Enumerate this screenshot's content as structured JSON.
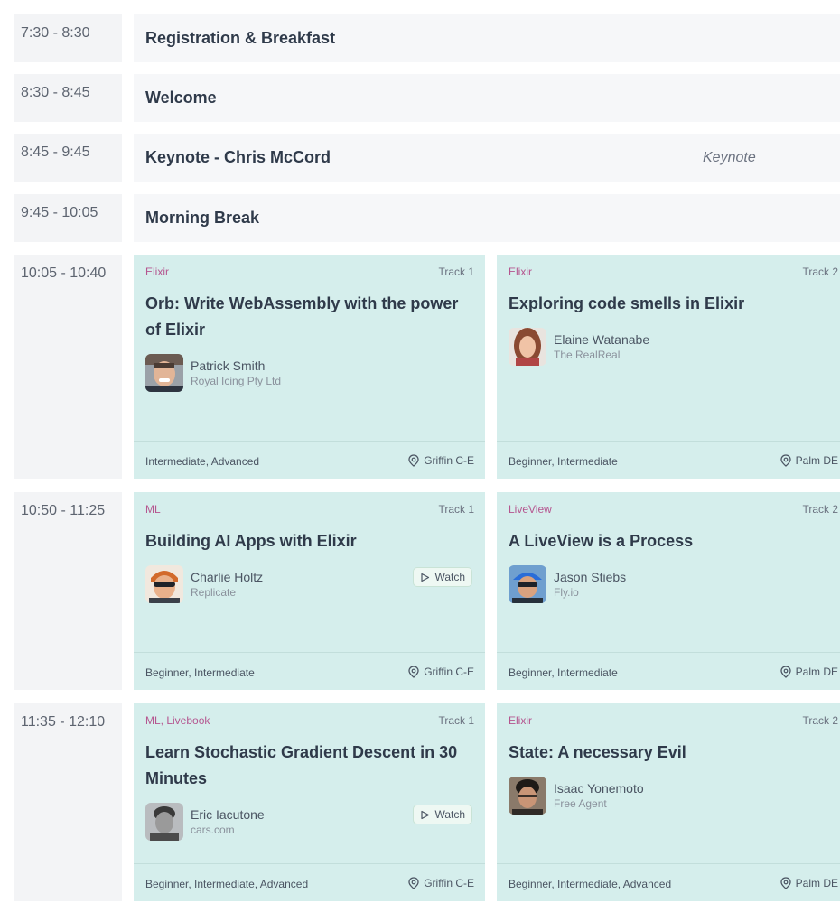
{
  "schedule": {
    "plenary": [
      {
        "time": "7:30 - 8:30",
        "title": "Registration & Breakfast",
        "tag": ""
      },
      {
        "time": "8:30 - 8:45",
        "title": "Welcome",
        "tag": ""
      },
      {
        "time": "8:45 - 9:45",
        "title": "Keynote - Chris McCord",
        "tag": "Keynote"
      },
      {
        "time": "9:45 - 10:05",
        "title": "Morning Break",
        "tag": ""
      }
    ],
    "slots": [
      {
        "time": "10:05 - 10:40",
        "talks": [
          {
            "topic": "Elixir",
            "track": "Track 1",
            "title": "Orb: Write WebAssembly with the power of Elixir",
            "speaker": "Patrick Smith",
            "org": "Royal Icing Pty Ltd",
            "levels": "Intermediate, Advanced",
            "room": "Griffin C-E",
            "watch": ""
          },
          {
            "topic": "Elixir",
            "track": "Track 2",
            "title": "Exploring code smells in Elixir",
            "speaker": "Elaine Watanabe",
            "org": "The RealReal",
            "levels": "Beginner, Intermediate",
            "room": "Palm DE",
            "watch": ""
          }
        ]
      },
      {
        "time": "10:50 - 11:25",
        "talks": [
          {
            "topic": "ML",
            "track": "Track 1",
            "title": "Building AI Apps with Elixir",
            "speaker": "Charlie Holtz",
            "org": "Replicate",
            "levels": "Beginner, Intermediate",
            "room": "Griffin C-E",
            "watch": "Watch"
          },
          {
            "topic": "LiveView",
            "track": "Track 2",
            "title": "A LiveView is a Process",
            "speaker": "Jason Stiebs",
            "org": "Fly.io",
            "levels": "Beginner, Intermediate",
            "room": "Palm DE",
            "watch": ""
          }
        ]
      },
      {
        "time": "11:35 - 12:10",
        "talks": [
          {
            "topic": "ML, Livebook",
            "track": "Track 1",
            "title": "Learn Stochastic Gradient Descent in 30 Minutes",
            "speaker": "Eric Iacutone",
            "org": "cars.com",
            "levels": "Beginner, Intermediate, Advanced",
            "room": "Griffin C-E",
            "watch": "Watch"
          },
          {
            "topic": "Elixir",
            "track": "Track 2",
            "title": "State: A necessary Evil",
            "speaker": "Isaac Yonemoto",
            "org": "Free Agent",
            "levels": "Beginner, Intermediate, Advanced",
            "room": "Palm DE",
            "watch": ""
          }
        ]
      }
    ]
  },
  "icons": {
    "pin": "location-pin-icon",
    "play": "play-icon"
  },
  "colors": {
    "card_bg": "#d5eeec",
    "topic": "#b5558f",
    "time_bg": "#f3f4f6",
    "event_bg": "#f6f7f9"
  }
}
